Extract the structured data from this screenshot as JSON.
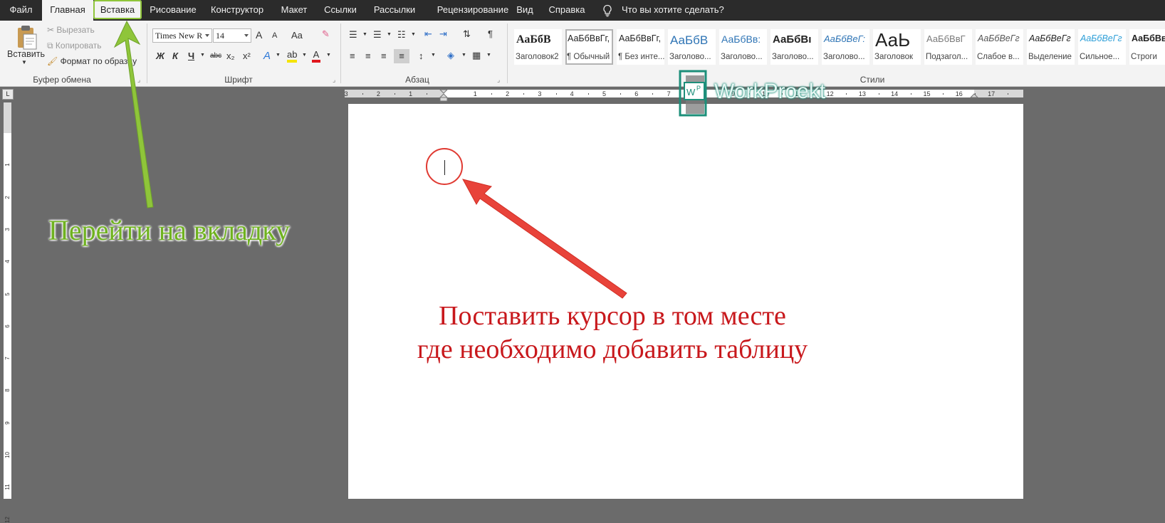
{
  "tabs": [
    {
      "id": "file",
      "label": "Файл"
    },
    {
      "id": "home",
      "label": "Главная"
    },
    {
      "id": "insert",
      "label": "Вставка"
    },
    {
      "id": "draw",
      "label": "Рисование"
    },
    {
      "id": "design",
      "label": "Конструктор"
    },
    {
      "id": "layout",
      "label": "Макет"
    },
    {
      "id": "references",
      "label": "Ссылки"
    },
    {
      "id": "mailings",
      "label": "Рассылки"
    },
    {
      "id": "review",
      "label": "Рецензирование"
    },
    {
      "id": "view",
      "label": "Вид"
    },
    {
      "id": "help",
      "label": "Справка"
    }
  ],
  "tell_me": "Что вы хотите сделать?",
  "clipboard": {
    "paste_label": "Вставить",
    "cut_label": "Вырезать",
    "copy_label": "Копировать",
    "format_painter_label": "Формат по образцу",
    "group_label": "Буфер обмена"
  },
  "font": {
    "name": "Times New R",
    "size": "14",
    "group_label": "Шрифт",
    "bold": "Ж",
    "italic": "К",
    "underline": "Ч",
    "strike": "abc",
    "subscript": "x₂",
    "superscript": "x²",
    "grow": "A",
    "shrink": "A",
    "case": "Aa"
  },
  "paragraph": {
    "group_label": "Абзац",
    "pilcrow": "¶"
  },
  "styles": {
    "group_label": "Стили",
    "items": [
      {
        "sample": "АаБбВ",
        "name": "Заголовок2"
      },
      {
        "sample": "АаБбВвГг,",
        "name": "¶ Обычный"
      },
      {
        "sample": "АаБбВвГг,",
        "name": "¶ Без инте..."
      },
      {
        "sample": "АаБбВ",
        "name": "Заголово..."
      },
      {
        "sample": "АаБбВв:",
        "name": "Заголово..."
      },
      {
        "sample": "АаБбВı",
        "name": "Заголово..."
      },
      {
        "sample": "АаБбВеГ:",
        "name": "Заголово..."
      },
      {
        "sample": "АаЬ",
        "name": "Заголовок"
      },
      {
        "sample": "АаБбВвГ",
        "name": "Подзагол..."
      },
      {
        "sample": "АаБбВеГг",
        "name": "Слабое в..."
      },
      {
        "sample": "АаБбВеГг",
        "name": "Выделение"
      },
      {
        "sample": "АаБбВеГг",
        "name": "Сильное..."
      },
      {
        "sample": "АаБбВв",
        "name": "Строги"
      }
    ]
  },
  "ruler": {
    "h_labels": [
      "3",
      "2",
      "1",
      "1",
      "2",
      "3",
      "4",
      "5",
      "6",
      "7",
      "8",
      "9",
      "10",
      "11",
      "12",
      "13",
      "14",
      "15",
      "16",
      "17"
    ],
    "v_labels": [
      "1",
      "2",
      "3",
      "4",
      "5",
      "6",
      "7",
      "8",
      "9",
      "10",
      "11",
      "12"
    ],
    "corner": "L"
  },
  "annotations": {
    "green": "Перейти на вкладку",
    "red_line1": "Поставить курсор в том месте",
    "red_line2": "где необходимо добавить таблицу"
  },
  "watermark": "WorkProekt",
  "colors": {
    "tabbar": "#2b2b2b",
    "ribbon": "#f3f3f3",
    "workspace": "#6b6b6b",
    "green_arrow": "#8fc53a",
    "red_arrow": "#e03a32",
    "red_text": "#c8181c"
  }
}
